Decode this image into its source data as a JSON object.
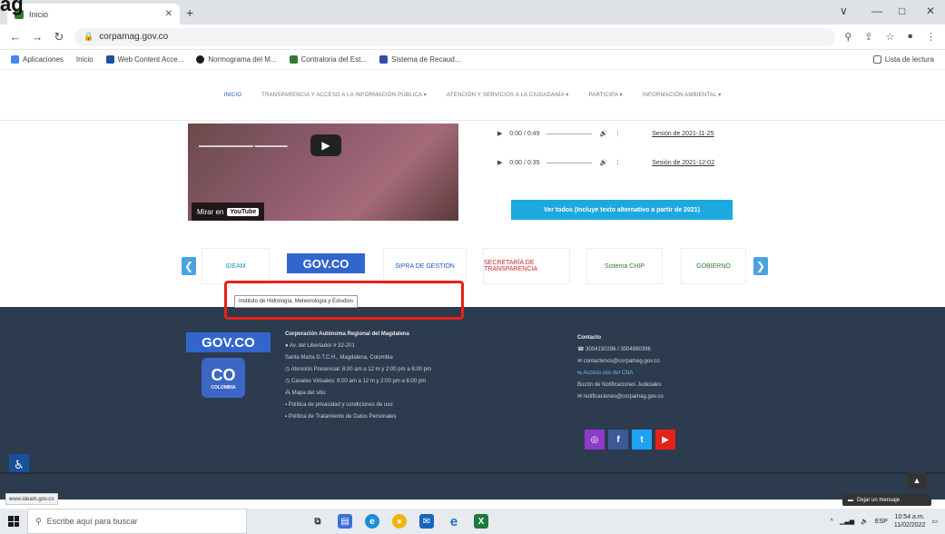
{
  "heading": "ag",
  "browser": {
    "tab_title": "Inicio",
    "new_tab": "+",
    "url": "corpamag.gov.co",
    "window_controls": [
      "∨",
      "—",
      "□",
      "✕"
    ]
  },
  "bookmarks": [
    {
      "label": "Aplicaciones",
      "color": "#4285f4"
    },
    {
      "label": "Inicio",
      "color": "#ffffff"
    },
    {
      "label": "Web Content Acce...",
      "color": "#1f4e9c"
    },
    {
      "label": "Normograma del M...",
      "color": "#1a1a1a"
    },
    {
      "label": "Contraloria del Est...",
      "color": "#2e7d32"
    },
    {
      "label": "Sistema de Recaud...",
      "color": "#3949ab"
    }
  ],
  "reading_list": "Lista de lectura",
  "site_nav": [
    "INICIO",
    "TRANSPARENCIA Y ACCESO A LA INFORMACIÓN PÚBLICA ▾",
    "ATENCIÓN Y SERVICIOS A LA CIUDADANÍA ▾",
    "PARTICIPA ▾",
    "INFORMACIÓN AMBIENTAL ▾"
  ],
  "video": {
    "watch_on": "Mirar en",
    "youtube": "YouTube"
  },
  "audios": [
    {
      "time": "0:00 / 0:49",
      "session": "Sesión de 2021-11-25"
    },
    {
      "time": "0:00 / 0:35",
      "session": "Sesión de 2021-12-02"
    }
  ],
  "ver_todos": "Ver todos (Incluye texto alternativo a partir de 2021)",
  "carousel": {
    "prev": "❮",
    "next": "❯",
    "logos": [
      {
        "label": "IDEAM"
      },
      {
        "label": "GOV.CO"
      },
      {
        "label": "SIPRA DE GESTIÓN"
      },
      {
        "label": "SECRETARÍA DE TRANSPARENCIA"
      },
      {
        "label": "Sistema CHIP"
      },
      {
        "label": "GOBIERNO"
      }
    ],
    "tooltip": "Instituto de Hidrología, Meteorología y Estudios"
  },
  "footer": {
    "gov_logo": "GOV.CO",
    "co_logo": "CO",
    "co_sub": "COLOMBIA",
    "org_title": "Corporación Autónoma Regional del Magdalena",
    "org_lines": [
      "Av. del Libertador # 32-201",
      "Santa Marta D.T.C.H., Magdalena, Colombia",
      "Atención Presencial: 8:00 am a 12 m y 2:00 pm a 6:00 pm",
      "Canales Virtuales: 8:00 am a 12 m y 2:00 pm a 6:00 pm",
      "Mapa del sitio",
      "Política de privacidad y condiciones de uso",
      "Política de Tratamiento de Datos Personales"
    ],
    "contact_title": "Contacto",
    "contact_lines": [
      "3004150296 / 3004980396",
      "contactenos@corpamag.gov.co",
      "Acceso uso del CNA",
      "Buzón de Notificaciones Judiciales",
      "notificaciones@corpamag.gov.co"
    ],
    "social": [
      {
        "label": "◎",
        "color": "#8e3bc8"
      },
      {
        "label": "f",
        "color": "#3b5998"
      },
      {
        "label": "t",
        "color": "#1da1f2"
      },
      {
        "label": "▶",
        "color": "#e62117"
      }
    ]
  },
  "status_url": "www.ideam.gov.co",
  "chat_button": "Dejar un mensaje",
  "accessibility": "♿",
  "to_top": "▲",
  "taskbar": {
    "search_placeholder": "Escribe aquí para buscar",
    "tray_lang": "ESP",
    "time": "10:54 a.m.",
    "date": "11/02/2022"
  }
}
